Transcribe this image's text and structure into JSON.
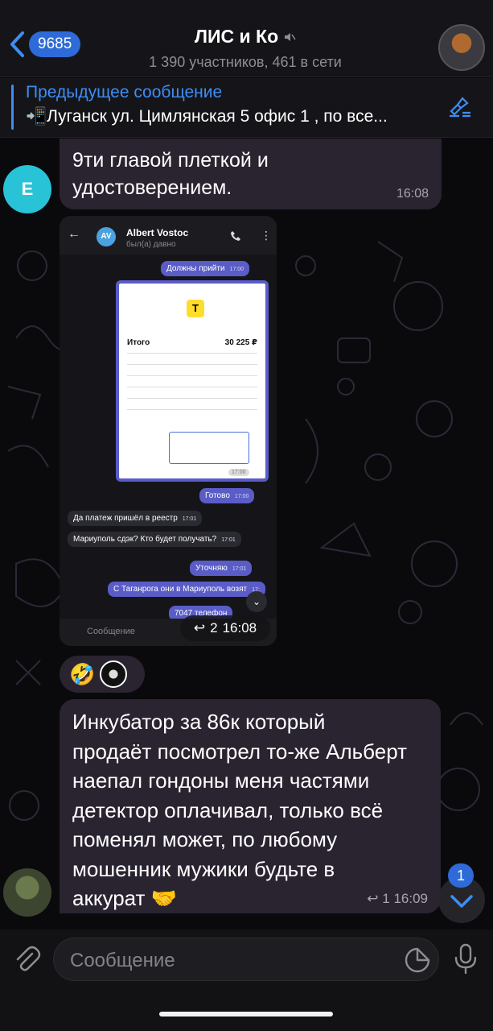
{
  "header": {
    "back_count": "9685",
    "title": "ЛИС и Ко",
    "subtitle": "1 390 участников, 461 в сети"
  },
  "pinned": {
    "label": "Предыдущее сообщение",
    "text": "📲Луганск ул. Цимлянская 5 офис 1 , по все..."
  },
  "messages": {
    "m1": {
      "avatar_letter": "E",
      "lines": [
        "9ти главой плеткой и",
        "удостоверением."
      ],
      "time": "16:08"
    },
    "forwarded_image": {
      "contact_name": "Albert Vostoc",
      "contact_initials": "AV",
      "contact_status": "был(а) давно",
      "msg_must_come": "Должны прийти",
      "msg_must_come_time": "17:00",
      "receipt_total_label": "Итого",
      "receipt_total_value": "30 225 ₽",
      "receipt_logo": "Т",
      "receipt_time": "17:00",
      "msg_ready": "Готово",
      "msg_ready_time": "17:00",
      "msg_payment": "Да платеж пришёл в реестр",
      "msg_payment_time": "17:01",
      "msg_mariupol": "Мариуполь сдэк? Кто будет получать?",
      "msg_mariupol_time": "17:01",
      "msg_clarify": "Уточняю",
      "msg_clarify_time": "17:01",
      "msg_taganrog": "С Таганрога они в Мариуполь возят",
      "msg_taganrog_time": "17:",
      "msg_phone": "7047 телефон",
      "input_placeholder": "Сообщение",
      "replies": "2",
      "time": "16:08"
    },
    "reactions": {
      "emoji": "🤣"
    },
    "m2": {
      "lines": [
        "Инкубатор за 86к который",
        "продаёт посмотрел то-же Альберт",
        "наепал гондоны меня частями",
        "детектор оплачивал, только всё",
        "поменял может, по любому",
        "мошенник мужики будьте в",
        "аккурат 🤝"
      ],
      "replies": "1",
      "time": "16:09"
    }
  },
  "scroll_badge": "1",
  "composer": {
    "placeholder": "Сообщение"
  },
  "colors": {
    "accent": "#2e6bd8",
    "bubble": "#2a2330",
    "link": "#3d8df5"
  }
}
